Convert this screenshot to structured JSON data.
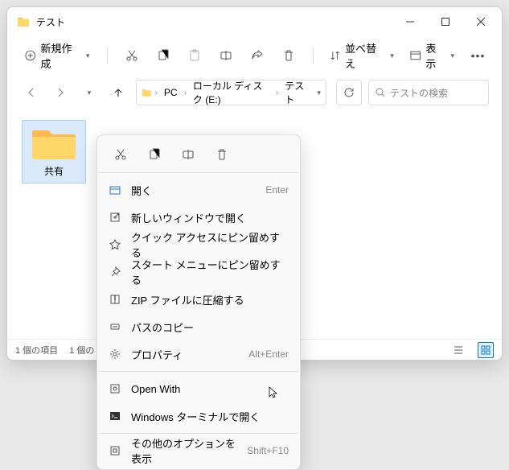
{
  "window": {
    "title": "テスト"
  },
  "toolbar": {
    "new_label": "新規作成",
    "sort_label": "並べ替え",
    "view_label": "表示"
  },
  "breadcrumb": {
    "items": [
      "PC",
      "ローカル ディスク (E:)",
      "テスト"
    ]
  },
  "search": {
    "placeholder": "テストの検索"
  },
  "folder_item": {
    "name": "共有"
  },
  "statusbar": {
    "count": "1 個の項目",
    "selected": "1 個の"
  },
  "context_menu": {
    "open": "開く",
    "open_hint": "Enter",
    "open_new_window": "新しいウィンドウで開く",
    "pin_quick": "クイック アクセスにピン留めする",
    "pin_start": "スタート メニューにピン留めする",
    "zip": "ZIP ファイルに圧縮する",
    "copy_path": "パスのコピー",
    "properties": "プロパティ",
    "properties_hint": "Alt+Enter",
    "open_with": "Open With",
    "terminal": "Windows ターミナルで開く",
    "more_options": "その他のオプションを表示",
    "more_options_hint": "Shift+F10"
  }
}
